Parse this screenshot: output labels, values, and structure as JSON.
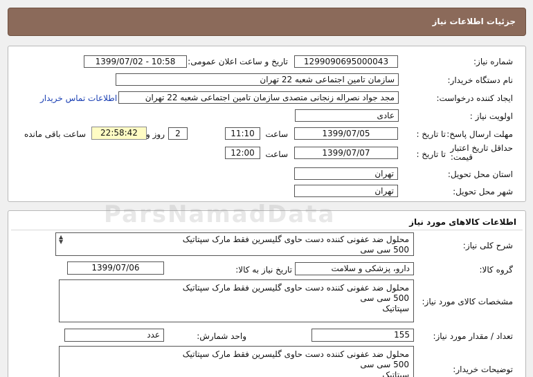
{
  "header": {
    "title": "جزئیات اطلاعات نیاز"
  },
  "need_info": {
    "need_number_label": "شماره نیاز:",
    "need_number": "1299090695000043",
    "announce_label": "تاریخ و ساعت اعلان عمومی:",
    "announce_value": "1399/07/02 - 10:58",
    "buyer_org_label": "نام دستگاه خریدار:",
    "buyer_org": "سازمان تامین اجتماعی شعبه 22 تهران",
    "requester_label": "ایجاد کننده درخواست:",
    "requester": "مجد جواد نصراله زنجانی متصدی سازمان تامین اجتماعی شعبه 22 تهران",
    "contact_link": "اطلاعات تماس خریدار",
    "priority_label": "اولویت نیاز :",
    "priority": "عادی",
    "reply_deadline_label": "مهلت ارسال پاسخ:",
    "to_date_label": "تا تاریخ :",
    "reply_date": "1399/07/05",
    "time_label": "ساعت",
    "reply_time": "11:10",
    "days_value": "2",
    "days_label": "روز و",
    "remaining_time": "22:58:42",
    "remaining_label": "ساعت باقی مانده",
    "price_validity_label_1": "حداقل تاریخ اعتبار",
    "price_validity_label_2": "قیمت:",
    "validity_date": "1399/07/07",
    "validity_time": "12:00",
    "province_label": "استان محل تحویل:",
    "province": "تهران",
    "city_label": "شهر محل تحویل:",
    "city": "تهران"
  },
  "goods": {
    "section_title": "اطلاعات کالاهای مورد نیاز",
    "general_desc_label": "شرح کلی نیاز:",
    "general_desc_lines": [
      "محلول ضد عفونی کننده دست حاوی گلیسرین فقط مارک سپتاتیک",
      "500 سی سی"
    ],
    "group_label": "گروه کالا:",
    "group": "دارو، پزشکی و سلامت",
    "need_date_label": "تاریخ نیاز به کالا:",
    "need_date": "1399/07/06",
    "specs_label": "مشخصات کالای مورد نیاز:",
    "specs_lines": [
      "محلول ضد عفونی کننده دست حاوی گلیسرین فقط مارک سپتاتیک",
      "500 سی سی",
      "سپتاتیک"
    ],
    "quantity_label": "تعداد / مقدار مورد نیاز:",
    "quantity": "155",
    "unit_label": "واحد شمارش:",
    "unit": "عدد",
    "buyer_notes_label": "توضیحات خریدار:",
    "buyer_notes_lines": [
      "محلول ضد عفونی کننده دست حاوی گلیسرین فقط مارک سپتاتیک",
      "500 سی سی",
      "سپتاتیک"
    ]
  },
  "watermark": "ParsNamadData"
}
